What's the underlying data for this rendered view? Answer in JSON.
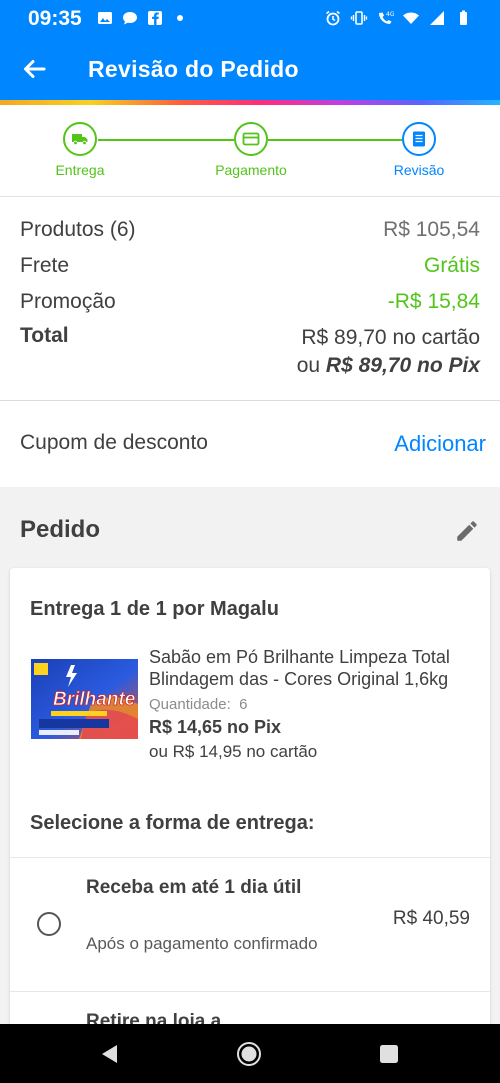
{
  "status_bar": {
    "time": "09:35",
    "network": "4G",
    "icons_left": [
      "gallery-icon",
      "chat-bubble-icon",
      "facebook-icon",
      "dot-icon"
    ],
    "icons_right": [
      "alarm-icon",
      "vibrate-icon",
      "call-4g-icon",
      "wifi-icon",
      "signal-icon",
      "battery-icon"
    ]
  },
  "app_bar": {
    "title": "Revisão do Pedido",
    "background": "#0086ff"
  },
  "stepper": {
    "steps": [
      {
        "label": "Entrega",
        "icon": "truck-icon",
        "state": "done"
      },
      {
        "label": "Pagamento",
        "icon": "credit-card-icon",
        "state": "done"
      },
      {
        "label": "Revisão",
        "icon": "receipt-icon",
        "state": "active"
      }
    ],
    "done_color": "#52c41a",
    "active_color": "#0086ff"
  },
  "summary": {
    "products_label": "Produtos (6)",
    "products_value": "R$ 105,54",
    "shipping_label": "Frete",
    "shipping_value": "Grátis",
    "promo_label": "Promoção",
    "promo_value": "-R$ 15,84",
    "total_label": "Total",
    "total_card": "R$ 89,70 no cartão",
    "total_pix_prefix": "ou",
    "total_pix": "R$ 89,70 no Pix"
  },
  "coupon": {
    "label": "Cupom de desconto",
    "action": "Adicionar"
  },
  "order": {
    "title": "Pedido",
    "shipment_title": "Entrega 1 de 1 por Magalu",
    "product": {
      "name": "Sabão em Pó Brilhante Limpeza Total Blindagem das - Cores Original 1,6kg",
      "quantity_label": "Quantidade:",
      "quantity": "6",
      "price_pix": "R$ 14,65 no Pix",
      "price_card": "ou R$ 14,95 no cartão",
      "image_brand": "Brilhante"
    },
    "delivery_title": "Selecione a forma de entrega:",
    "delivery_options": [
      {
        "title": "Receba em até 1 dia útil",
        "subtitle": "Após o pagamento confirmado",
        "price": "R$ 40,59",
        "selected": false
      },
      {
        "title": "Retire na loja a",
        "subtitle": "",
        "price": "",
        "selected": false
      }
    ]
  },
  "colors": {
    "primary": "#0086ff",
    "success": "#52c41a",
    "text": "#404040"
  }
}
